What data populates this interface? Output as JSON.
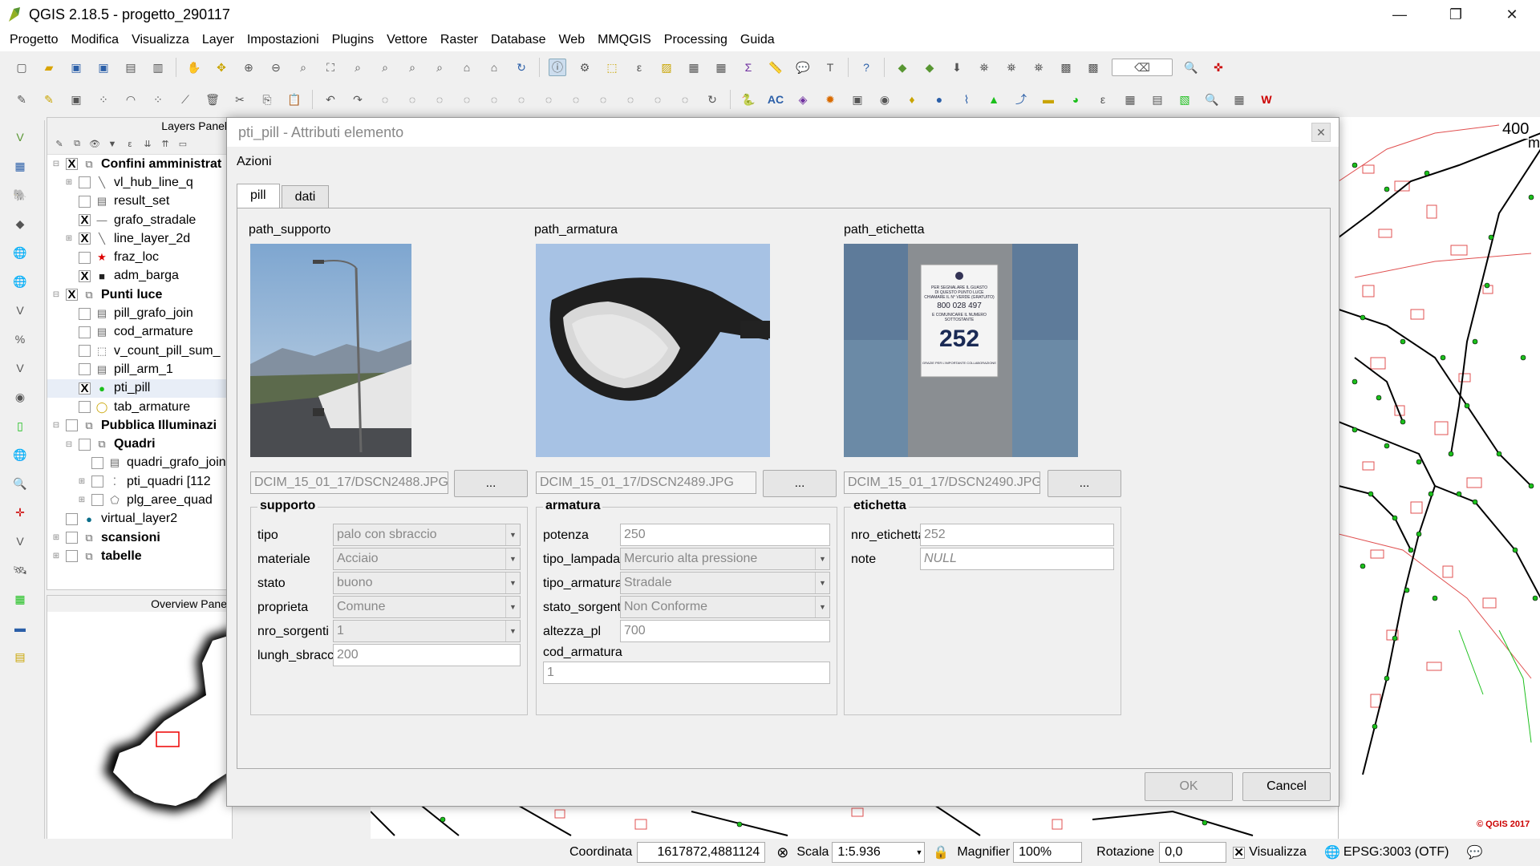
{
  "window": {
    "title": "QGIS 2.18.5 - progetto_290117",
    "minimize": "—",
    "restore": "❐",
    "close": "✕"
  },
  "menu": [
    "Progetto",
    "Modifica",
    "Visualizza",
    "Layer",
    "Impostazioni",
    "Plugins",
    "Vettore",
    "Raster",
    "Database",
    "Web",
    "MMQGIS",
    "Processing",
    "Guida"
  ],
  "layers_panel": {
    "title": "Layers Panel",
    "layers": [
      {
        "label": "Confini amministrat",
        "check": "X",
        "bold": true,
        "exp": "⊟",
        "indent": 0,
        "icon": "group-icon"
      },
      {
        "label": "vl_hub_line_q",
        "check": "",
        "bold": false,
        "exp": "⊞",
        "indent": 1,
        "icon": "line-layer-icon"
      },
      {
        "label": "result_set",
        "check": "",
        "bold": false,
        "exp": "",
        "indent": 1,
        "icon": "table-icon"
      },
      {
        "label": "grafo_stradale",
        "check": "X",
        "bold": false,
        "exp": "",
        "indent": 1,
        "icon": "line-icon"
      },
      {
        "label": "line_layer_2d",
        "check": "X",
        "bold": false,
        "exp": "⊞",
        "indent": 1,
        "icon": "line-layer-icon"
      },
      {
        "label": "fraz_loc",
        "check": "",
        "bold": false,
        "exp": "",
        "indent": 1,
        "icon": "star-icon"
      },
      {
        "label": "adm_barga",
        "check": "X",
        "bold": false,
        "exp": "",
        "indent": 1,
        "icon": "polygon-icon"
      },
      {
        "label": "Punti luce",
        "check": "X",
        "bold": true,
        "exp": "⊟",
        "indent": 0,
        "icon": "group-icon"
      },
      {
        "label": "pill_grafo_join",
        "check": "",
        "bold": false,
        "exp": "",
        "indent": 1,
        "icon": "table-icon"
      },
      {
        "label": "cod_armature",
        "check": "",
        "bold": false,
        "exp": "",
        "indent": 1,
        "icon": "table-icon"
      },
      {
        "label": "v_count_pill_sum_",
        "check": "",
        "bold": false,
        "exp": "",
        "indent": 1,
        "icon": "dotted-box-icon"
      },
      {
        "label": "pill_arm_1",
        "check": "",
        "bold": false,
        "exp": "",
        "indent": 1,
        "icon": "table-icon"
      },
      {
        "label": "pti_pill",
        "check": "X",
        "bold": false,
        "exp": "",
        "indent": 1,
        "icon": "point-icon"
      },
      {
        "label": "tab_armature",
        "check": "",
        "bold": false,
        "exp": "",
        "indent": 1,
        "icon": "circle-yellow-icon"
      },
      {
        "label": "Pubblica Illuminazi",
        "check": "",
        "bold": true,
        "exp": "⊟",
        "indent": 0,
        "icon": "group-icon"
      },
      {
        "label": "Quadri",
        "check": "",
        "bold": true,
        "exp": "⊟",
        "indent": 1,
        "icon": "group-icon"
      },
      {
        "label": "quadri_grafo_join",
        "check": "",
        "bold": false,
        "exp": "",
        "indent": 2,
        "icon": "table-icon"
      },
      {
        "label": "pti_quadri [112",
        "check": "",
        "bold": false,
        "exp": "⊞",
        "indent": 2,
        "icon": "points-icon"
      },
      {
        "label": "plg_aree_quad",
        "check": "",
        "bold": false,
        "exp": "⊞",
        "indent": 2,
        "icon": "polygon-outline-icon"
      },
      {
        "label": "virtual_layer2",
        "check": "",
        "bold": false,
        "exp": "",
        "indent": 0,
        "icon": "point-blue-icon"
      },
      {
        "label": "scansioni",
        "check": "",
        "bold": true,
        "exp": "⊞",
        "indent": 0,
        "icon": "group-icon"
      },
      {
        "label": "tabelle",
        "check": "",
        "bold": true,
        "exp": "⊞",
        "indent": 0,
        "icon": "group-icon"
      }
    ]
  },
  "overview_panel": {
    "title": "Overview Pane"
  },
  "map": {
    "scale_label": "400",
    "scale_unit": "m",
    "copyright": "© QGIS 2017"
  },
  "dialog": {
    "title": "pti_pill - Attributi elemento",
    "azioni": "Azioni",
    "tabs": [
      "pill",
      "dati"
    ],
    "photos": [
      {
        "label": "path_supporto",
        "path": "DCIM_15_01_17/DSCN2488.JPG",
        "button": "..."
      },
      {
        "label": "path_armatura",
        "path": "DCIM_15_01_17/DSCN2489.JPG",
        "button": "..."
      },
      {
        "label": "path_etichetta",
        "path": "DCIM_15_01_17/DSCN2490.JPG",
        "button": "..."
      }
    ],
    "label_photo_text": {
      "line1": "PER SEGNALARE IL GUASTO",
      "line2": "DI QUESTO PUNTO LUCE",
      "line3": "CHIAMARE IL N° VERDE (GRATUITO)",
      "phone": "800 028 497",
      "line4": "E COMUNICARE IL NUMERO",
      "line5": "SOTTOSTANTE",
      "number": "252",
      "footer": "GRAZIE PER L'IMPORTANTE COLLABORAZIONE"
    },
    "supporto": {
      "title": "supporto",
      "fields": [
        {
          "label": "tipo",
          "value": "palo con sbraccio",
          "type": "combo"
        },
        {
          "label": "materiale",
          "value": "Acciaio",
          "type": "combo"
        },
        {
          "label": "stato",
          "value": "buono",
          "type": "combo"
        },
        {
          "label": "proprieta",
          "value": "Comune",
          "type": "combo"
        },
        {
          "label": "nro_sorgenti",
          "value": "1",
          "type": "combo"
        },
        {
          "label": "lungh_sbraccio",
          "value": "200",
          "type": "input"
        }
      ]
    },
    "armatura": {
      "title": "armatura",
      "fields": [
        {
          "label": "potenza",
          "value": "250",
          "type": "input"
        },
        {
          "label": "tipo_lampada",
          "value": "Mercurio alta pressione",
          "type": "combo"
        },
        {
          "label": "tipo_armatura",
          "value": "Stradale",
          "type": "combo"
        },
        {
          "label": "stato_sorgente",
          "value": "Non Conforme",
          "type": "combo"
        },
        {
          "label": "altezza_pl",
          "value": "700",
          "type": "input"
        }
      ],
      "cod_label": "cod_armatura",
      "cod_value": "1"
    },
    "etichetta": {
      "title": "etichetta",
      "fields": [
        {
          "label": "nro_etichetta",
          "value": "252",
          "type": "input"
        },
        {
          "label": "note",
          "value": "NULL",
          "type": "input"
        }
      ]
    },
    "ok": "OK",
    "cancel": "Cancel"
  },
  "status": {
    "coord_label": "Coordinata",
    "coord_value": "1617872,4881124",
    "scale_label": "Scala",
    "scale_value": "1:5.936",
    "magnifier_label": "Magnifier",
    "magnifier_value": "100%",
    "rotation_label": "Rotazione",
    "rotation_value": "0,0",
    "render_label": "Visualizza",
    "crs": "EPSG:3003 (OTF)"
  },
  "colors": {
    "accent": "#2b5fa8",
    "point_green": "#1bbf1b",
    "road_red": "#e05050"
  }
}
